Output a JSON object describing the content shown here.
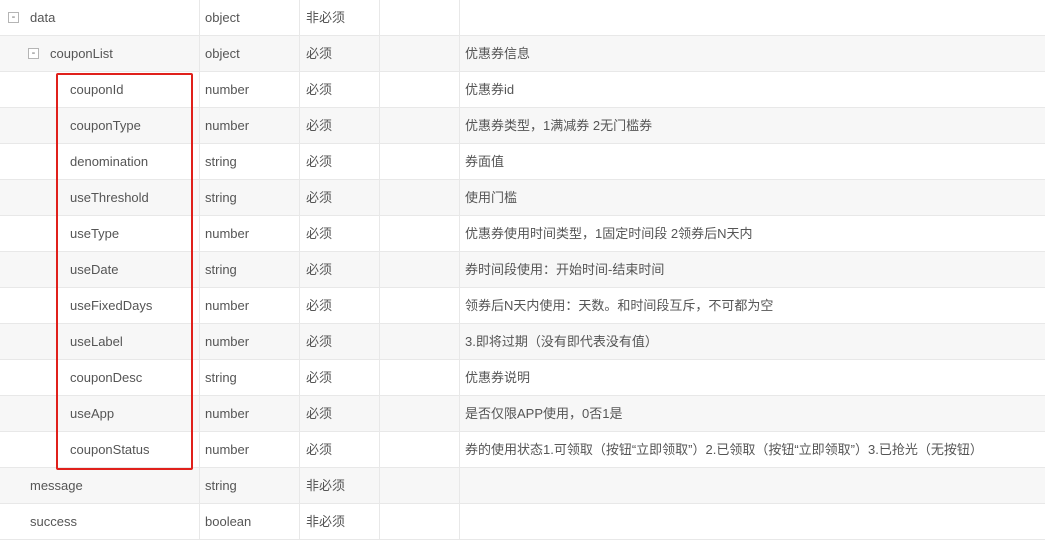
{
  "rows": [
    {
      "name": "data",
      "type": "object",
      "required": "非必须",
      "desc": "",
      "level": 0,
      "toggle": "-"
    },
    {
      "name": "couponList",
      "type": "object",
      "required": "必须",
      "desc": "优惠券信息",
      "level": 1,
      "toggle": "-"
    },
    {
      "name": "couponId",
      "type": "number",
      "required": "必须",
      "desc": "优惠券id",
      "level": 2
    },
    {
      "name": "couponType",
      "type": "number",
      "required": "必须",
      "desc": "优惠券类型，1满减券 2无门槛券",
      "level": 2
    },
    {
      "name": "denomination",
      "type": "string",
      "required": "必须",
      "desc": "券面值",
      "level": 2
    },
    {
      "name": "useThreshold",
      "type": "string",
      "required": "必须",
      "desc": "使用门槛",
      "level": 2
    },
    {
      "name": "useType",
      "type": "number",
      "required": "必须",
      "desc": "优惠券使用时间类型，1固定时间段 2领券后N天内",
      "level": 2
    },
    {
      "name": "useDate",
      "type": "string",
      "required": "必须",
      "desc": "券时间段使用：开始时间-结束时间",
      "level": 2
    },
    {
      "name": "useFixedDays",
      "type": "number",
      "required": "必须",
      "desc": "领券后N天内使用：天数。和时间段互斥，不可都为空",
      "level": 2
    },
    {
      "name": "useLabel",
      "type": "number",
      "required": "必须",
      "desc": "3.即将过期（没有即代表没有值）",
      "level": 2
    },
    {
      "name": "couponDesc",
      "type": "string",
      "required": "必须",
      "desc": "优惠券说明",
      "level": 2
    },
    {
      "name": "useApp",
      "type": "number",
      "required": "必须",
      "desc": "是否仅限APP使用，0否1是",
      "level": 2
    },
    {
      "name": "couponStatus",
      "type": "number",
      "required": "必须",
      "desc": "券的使用状态1.可领取（按钮“立即领取”）2.已领取（按钮“立即领取”）3.已抢光（无按钮）",
      "level": 2
    },
    {
      "name": "message",
      "type": "string",
      "required": "非必须",
      "desc": "",
      "level": 0
    },
    {
      "name": "success",
      "type": "boolean",
      "required": "非必须",
      "desc": "",
      "level": 0
    }
  ],
  "colors": {
    "highlight": "#e0201b",
    "zebra": "#f7f7f7",
    "border": "#e8e8e8",
    "text": "#555555"
  }
}
